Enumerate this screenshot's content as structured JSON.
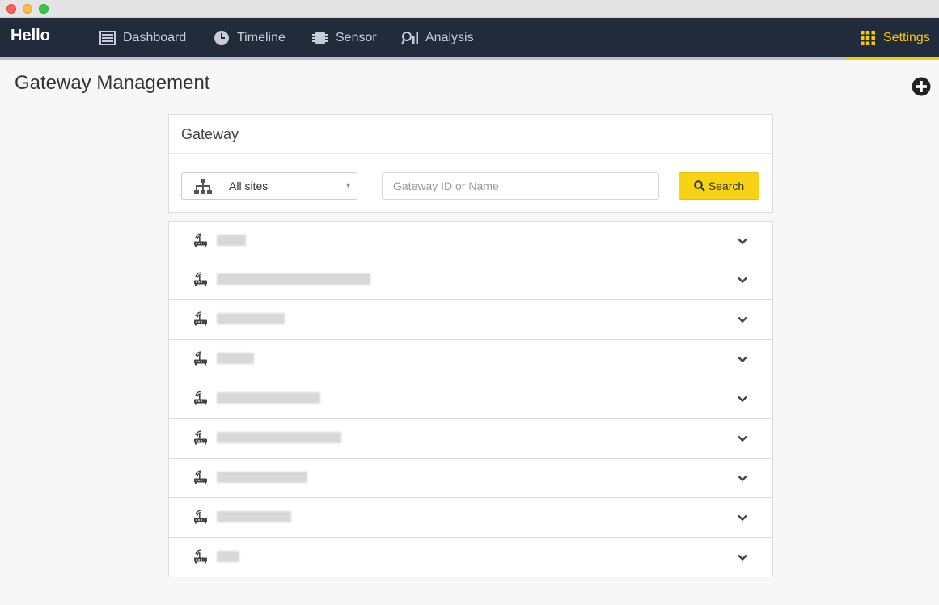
{
  "app": {
    "brand": "Hello"
  },
  "nav": {
    "items": [
      {
        "label": "Dashboard",
        "icon": "dashboard-icon"
      },
      {
        "label": "Timeline",
        "icon": "clock-icon"
      },
      {
        "label": "Sensor",
        "icon": "chip-icon"
      },
      {
        "label": "Analysis",
        "icon": "analysis-icon"
      },
      {
        "label": "Settings",
        "icon": "grid-icon",
        "active": true
      }
    ]
  },
  "page": {
    "title": "Gateway Management"
  },
  "panel": {
    "title": "Gateway",
    "site_select": {
      "value": "All sites"
    },
    "search": {
      "placeholder": "Gateway ID or Name",
      "button_label": "Search"
    }
  },
  "gateways": [
    {
      "name": "",
      "icon": "router-icon"
    },
    {
      "name": "",
      "icon": "router-icon"
    },
    {
      "name": "",
      "icon": "router-icon"
    },
    {
      "name": "",
      "icon": "router-icon"
    },
    {
      "name": "",
      "icon": "router-icon"
    },
    {
      "name": "",
      "icon": "router-icon"
    },
    {
      "name": "",
      "icon": "router-icon"
    },
    {
      "name": "",
      "icon": "router-icon"
    },
    {
      "name": "",
      "icon": "router-icon"
    }
  ],
  "colors": {
    "nav_bg": "#222b3b",
    "accent": "#f5c800",
    "search_btn": "#f7d314"
  }
}
